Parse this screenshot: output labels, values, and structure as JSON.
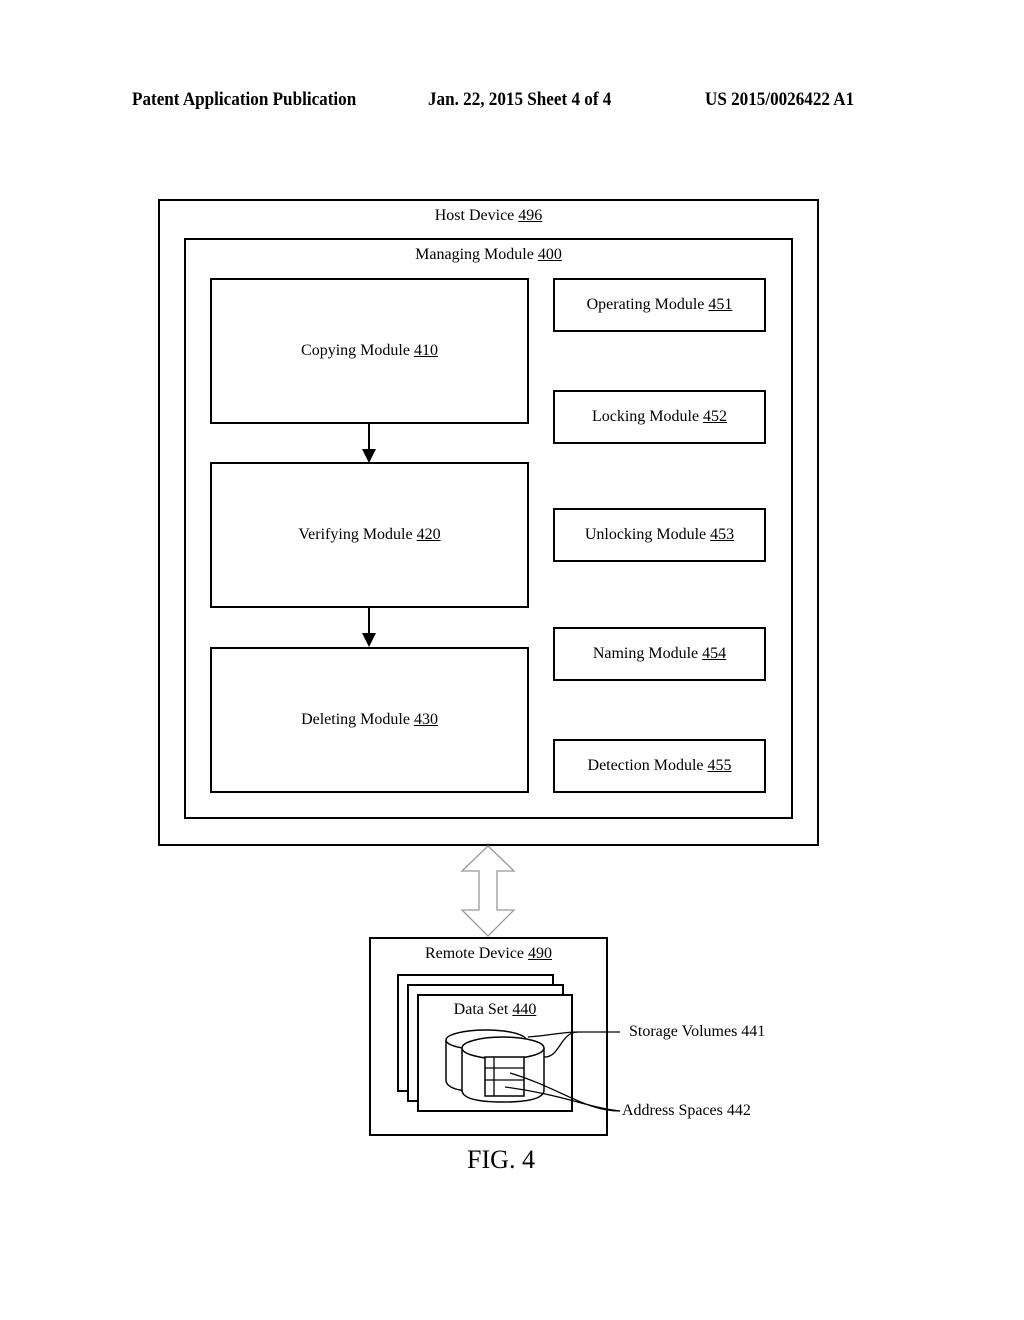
{
  "header": {
    "publication": "Patent Application Publication",
    "date_sheet": "Jan. 22, 2015  Sheet 4 of 4",
    "number": "US 2015/0026422 A1"
  },
  "host_device": {
    "name": "Host Device",
    "ref": "496"
  },
  "managing_module": {
    "name": "Managing Module",
    "ref": "400"
  },
  "flow_modules": [
    {
      "name": "Copying Module",
      "ref": "410"
    },
    {
      "name": "Verifying Module",
      "ref": "420"
    },
    {
      "name": "Deleting Module",
      "ref": "430"
    }
  ],
  "side_modules": [
    {
      "name": "Operating Module",
      "ref": "451"
    },
    {
      "name": "Locking Module",
      "ref": "452"
    },
    {
      "name": "Unlocking Module",
      "ref": "453"
    },
    {
      "name": "Naming Module",
      "ref": "454"
    },
    {
      "name": "Detection Module",
      "ref": "455"
    }
  ],
  "remote_device": {
    "name": "Remote Device",
    "ref": "490"
  },
  "data_set": {
    "name": "Data Set",
    "ref": "440"
  },
  "callouts": {
    "storage_volumes": "Storage Volumes 441",
    "address_spaces": "Address Spaces 442"
  },
  "figure_label": "FIG. 4"
}
